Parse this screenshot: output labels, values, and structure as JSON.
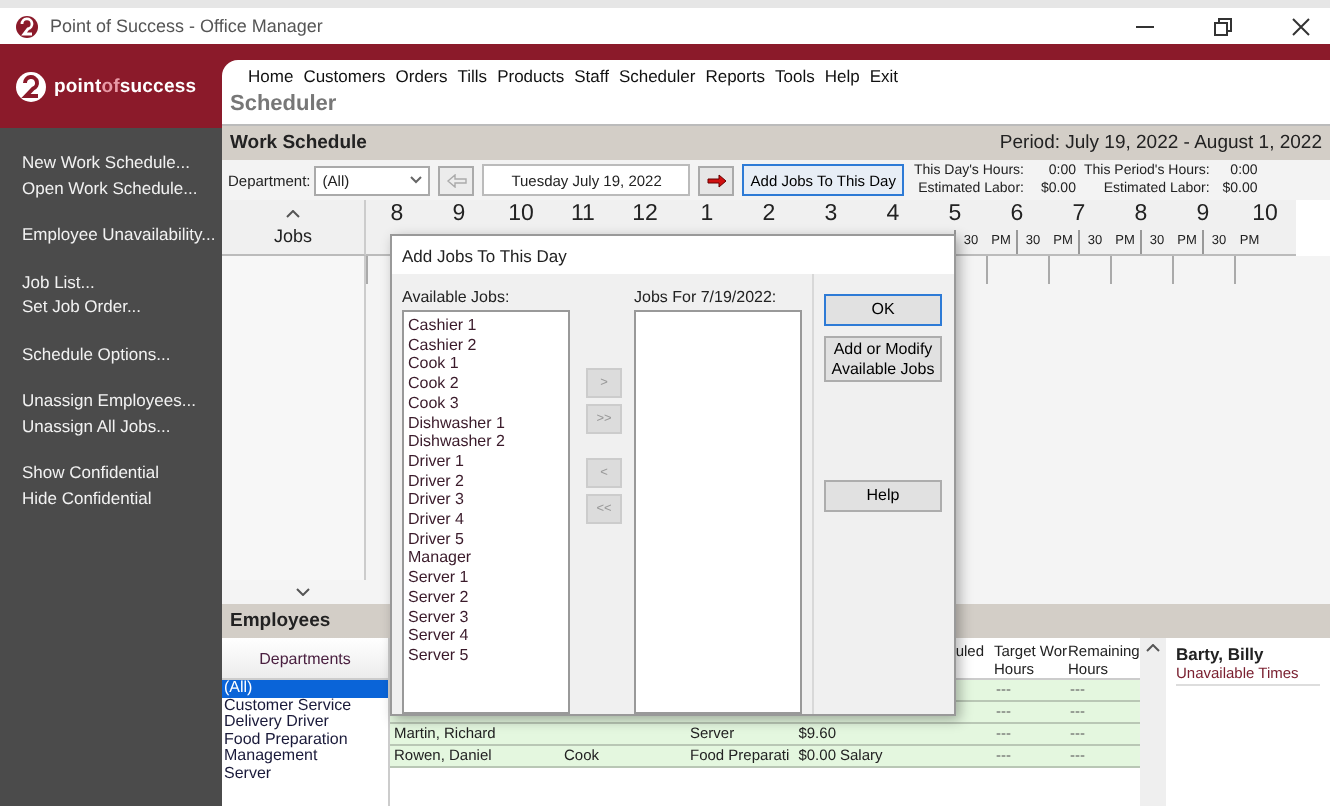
{
  "window": {
    "title": "Point of Success - Office Manager"
  },
  "logo": {
    "parts": [
      {
        "text": "point",
        "accent": false
      },
      {
        "text": "of",
        "accent": true
      },
      {
        "text": "success",
        "accent": false
      }
    ]
  },
  "sidebar": {
    "groups": [
      [
        "New Work Schedule...",
        "Open Work Schedule..."
      ],
      [
        "Employee Unavailability..."
      ],
      [
        "Job List...",
        "Set Job Order..."
      ],
      [
        "Schedule Options..."
      ],
      [
        "Unassign Employees...",
        "Unassign All Jobs..."
      ],
      [
        "Show Confidential",
        "Hide Confidential"
      ]
    ]
  },
  "menu": [
    "Home",
    "Customers",
    "Orders",
    "Tills",
    "Products",
    "Staff",
    "Scheduler",
    "Reports",
    "Tools",
    "Help",
    "Exit"
  ],
  "page_title": "Scheduler",
  "work_schedule": {
    "title": "Work Schedule",
    "period": "Period: July 19, 2022 - August 1, 2022"
  },
  "toolbar": {
    "department_label": "Department:",
    "department": "(All)",
    "previous_disabled": true,
    "date": "Tuesday July 19, 2022",
    "add_jobs_button": "Add Jobs To This Day",
    "stats": [
      {
        "label": "This Day's Hours:",
        "value": "0:00"
      },
      {
        "label": "Estimated Labor:",
        "value": "$0.00"
      },
      {
        "label": "This Period's Hours:",
        "value": "0:00"
      },
      {
        "label": "Estimated Labor:",
        "value": "$0.00"
      }
    ]
  },
  "schedule": {
    "jobs_header": "Jobs",
    "hours": [
      {
        "label": "8"
      },
      {
        "label": "9"
      },
      {
        "label": "10"
      },
      {
        "label": "11"
      },
      {
        "label": "12"
      },
      {
        "label": "1"
      },
      {
        "label": "2"
      },
      {
        "label": "3"
      },
      {
        "label": "4"
      },
      {
        "label": "5",
        "half": "30"
      },
      {
        "label": "6",
        "pm": "PM",
        "half": "30"
      },
      {
        "label": "7",
        "pm": "PM",
        "half": "30"
      },
      {
        "label": "8",
        "pm": "PM",
        "half": "30"
      },
      {
        "label": "9",
        "pm": "PM",
        "half": "30"
      },
      {
        "label": "10",
        "pm": "PM"
      }
    ]
  },
  "employees": {
    "title": "Employees",
    "departments_header": "Departments",
    "departments": [
      {
        "name": "(All)",
        "selected": true
      },
      {
        "name": "Customer Service",
        "selected": false
      },
      {
        "name": "Delivery Driver",
        "selected": false
      },
      {
        "name": "Food Preparation",
        "selected": false
      },
      {
        "name": "Management",
        "selected": false
      },
      {
        "name": "Server",
        "selected": false
      }
    ],
    "columns": [
      {
        "lines": [
          "uled"
        ]
      },
      {
        "lines": [
          "Target Wor",
          "Hours"
        ]
      },
      {
        "lines": [
          "Remaining",
          "Hours"
        ]
      }
    ],
    "rows": [
      {
        "target": "---",
        "remaining": "---"
      },
      {
        "target": "---",
        "remaining": "---"
      },
      {
        "name": "Martin, Richard",
        "department": "Server",
        "rate": "$9.60",
        "target": "---",
        "remaining": "---"
      },
      {
        "name": "Rowen, Daniel",
        "job": "Cook",
        "department": "Food Preparati",
        "rate": "$0.00",
        "pay_type": "Salary",
        "target": "---",
        "remaining": "---"
      }
    ]
  },
  "detail": {
    "name": "Barty, Billy",
    "subtitle": "Unavailable Times"
  },
  "dialog": {
    "title": "Add Jobs To This Day",
    "available_label": "Available Jobs:",
    "available": [
      "Cashier 1",
      "Cashier 2",
      "Cook 1",
      "Cook 2",
      "Cook 3",
      "Dishwasher 1",
      "Dishwasher 2",
      "Driver 1",
      "Driver 2",
      "Driver 3",
      "Driver 4",
      "Driver 5",
      "Manager",
      "Server 1",
      "Server 2",
      "Server 3",
      "Server 4",
      "Server 5"
    ],
    "assigned_label": "Jobs For 7/19/2022:",
    "move_buttons": [
      {
        "label": ">",
        "disabled": true
      },
      {
        "label": ">>",
        "disabled": true
      },
      {
        "label": "<",
        "disabled": true
      },
      {
        "label": "<<",
        "disabled": true
      }
    ],
    "buttons": [
      {
        "label": "OK",
        "default": true
      },
      {
        "label": "Add or Modify Available Jobs",
        "default": false
      },
      {
        "label": "Help",
        "default": false
      }
    ]
  }
}
